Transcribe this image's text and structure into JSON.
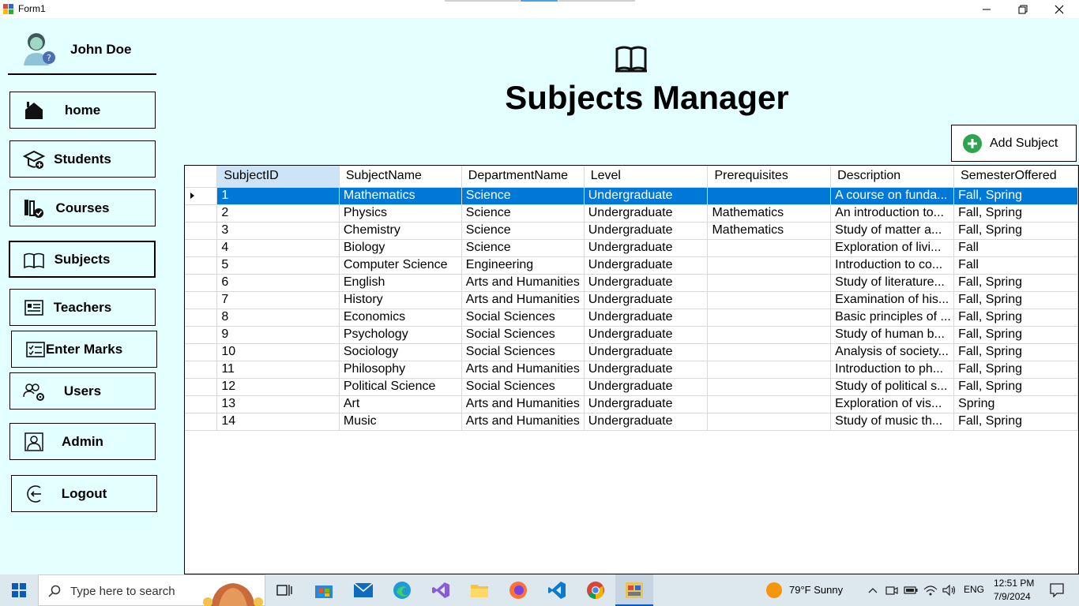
{
  "window": {
    "title": "Form1"
  },
  "sidebar": {
    "user_name": "John Doe",
    "items": [
      {
        "label": "home",
        "icon": "home-icon"
      },
      {
        "label": "Students",
        "icon": "graduation-cap-icon"
      },
      {
        "label": "Courses",
        "icon": "books-check-icon"
      },
      {
        "label": "Subjects",
        "icon": "open-book-icon",
        "active": true
      },
      {
        "label": "Teachers",
        "icon": "id-card-icon"
      },
      {
        "label": "Enter Marks",
        "icon": "checklist-icon"
      },
      {
        "label": "Users",
        "icon": "users-gear-icon"
      },
      {
        "label": "Admin",
        "icon": "admin-portrait-icon"
      },
      {
        "label": "Logout",
        "icon": "logout-icon"
      }
    ]
  },
  "main": {
    "title": "Subjects Manager",
    "add_button_label": "Add Subject"
  },
  "grid": {
    "columns": [
      "SubjectID",
      "SubjectName",
      "DepartmentName",
      "Level",
      "Prerequisites",
      "Description",
      "SemesterOffered"
    ],
    "rows": [
      [
        "1",
        "Mathematics",
        "Science",
        "Undergraduate",
        "",
        "A course on funda...",
        "Fall, Spring"
      ],
      [
        "2",
        "Physics",
        "Science",
        "Undergraduate",
        "Mathematics",
        "An introduction to...",
        "Fall, Spring"
      ],
      [
        "3",
        "Chemistry",
        "Science",
        "Undergraduate",
        "Mathematics",
        "Study of matter a...",
        "Fall, Spring"
      ],
      [
        "4",
        "Biology",
        "Science",
        "Undergraduate",
        "",
        "Exploration of livi...",
        "Fall"
      ],
      [
        "5",
        "Computer Science",
        "Engineering",
        "Undergraduate",
        "",
        "Introduction to co...",
        "Fall"
      ],
      [
        "6",
        "English",
        "Arts and Humanities",
        "Undergraduate",
        "",
        "Study of literature...",
        "Fall, Spring"
      ],
      [
        "7",
        "History",
        "Arts and Humanities",
        "Undergraduate",
        "",
        "Examination of his...",
        "Fall, Spring"
      ],
      [
        "8",
        "Economics",
        "Social Sciences",
        "Undergraduate",
        "",
        "Basic principles of ...",
        "Fall, Spring"
      ],
      [
        "9",
        "Psychology",
        "Social Sciences",
        "Undergraduate",
        "",
        "Study of human b...",
        "Fall, Spring"
      ],
      [
        "10",
        "Sociology",
        "Social Sciences",
        "Undergraduate",
        "",
        "Analysis of society...",
        "Fall, Spring"
      ],
      [
        "11",
        "Philosophy",
        "Arts and Humanities",
        "Undergraduate",
        "",
        "Introduction to ph...",
        "Fall, Spring"
      ],
      [
        "12",
        "Political Science",
        "Social Sciences",
        "Undergraduate",
        "",
        "Study of political s...",
        "Fall, Spring"
      ],
      [
        "13",
        "Art",
        "Arts and Humanities",
        "Undergraduate",
        "",
        "Exploration of vis...",
        "Spring"
      ],
      [
        "14",
        "Music",
        "Arts and Humanities",
        "Undergraduate",
        "",
        "Study of music th...",
        "Fall, Spring"
      ]
    ],
    "selected_row": 0
  },
  "taskbar": {
    "search_placeholder": "Type here to search",
    "weather": "79°F  Sunny",
    "language": "ENG",
    "time": "12:51 PM",
    "date": "7/9/2024"
  },
  "colors": {
    "background": "#e4ffff",
    "selection": "#0078d7",
    "header_selected": "#cde4f7",
    "add_icon": "#2ea44f"
  }
}
